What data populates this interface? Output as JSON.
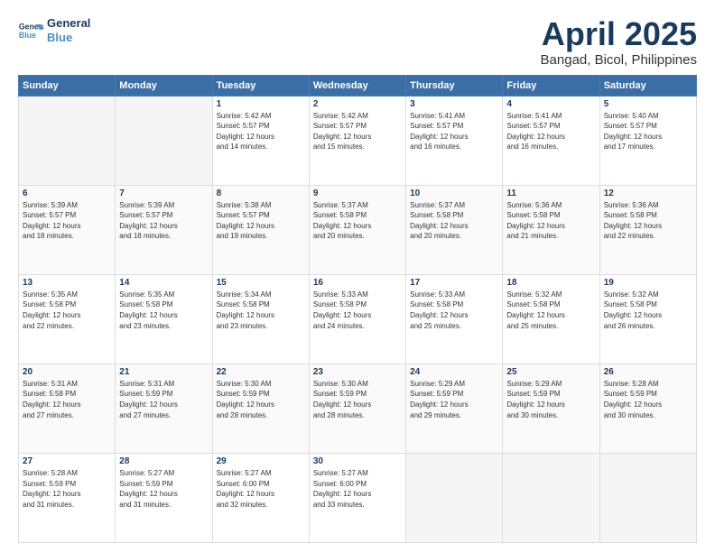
{
  "header": {
    "logo_line1": "General",
    "logo_line2": "Blue",
    "title": "April 2025",
    "subtitle": "Bangad, Bicol, Philippines"
  },
  "days_of_week": [
    "Sunday",
    "Monday",
    "Tuesday",
    "Wednesday",
    "Thursday",
    "Friday",
    "Saturday"
  ],
  "weeks": [
    [
      {
        "num": "",
        "text": ""
      },
      {
        "num": "",
        "text": ""
      },
      {
        "num": "1",
        "text": "Sunrise: 5:42 AM\nSunset: 5:57 PM\nDaylight: 12 hours\nand 14 minutes."
      },
      {
        "num": "2",
        "text": "Sunrise: 5:42 AM\nSunset: 5:57 PM\nDaylight: 12 hours\nand 15 minutes."
      },
      {
        "num": "3",
        "text": "Sunrise: 5:41 AM\nSunset: 5:57 PM\nDaylight: 12 hours\nand 16 minutes."
      },
      {
        "num": "4",
        "text": "Sunrise: 5:41 AM\nSunset: 5:57 PM\nDaylight: 12 hours\nand 16 minutes."
      },
      {
        "num": "5",
        "text": "Sunrise: 5:40 AM\nSunset: 5:57 PM\nDaylight: 12 hours\nand 17 minutes."
      }
    ],
    [
      {
        "num": "6",
        "text": "Sunrise: 5:39 AM\nSunset: 5:57 PM\nDaylight: 12 hours\nand 18 minutes."
      },
      {
        "num": "7",
        "text": "Sunrise: 5:39 AM\nSunset: 5:57 PM\nDaylight: 12 hours\nand 18 minutes."
      },
      {
        "num": "8",
        "text": "Sunrise: 5:38 AM\nSunset: 5:57 PM\nDaylight: 12 hours\nand 19 minutes."
      },
      {
        "num": "9",
        "text": "Sunrise: 5:37 AM\nSunset: 5:58 PM\nDaylight: 12 hours\nand 20 minutes."
      },
      {
        "num": "10",
        "text": "Sunrise: 5:37 AM\nSunset: 5:58 PM\nDaylight: 12 hours\nand 20 minutes."
      },
      {
        "num": "11",
        "text": "Sunrise: 5:36 AM\nSunset: 5:58 PM\nDaylight: 12 hours\nand 21 minutes."
      },
      {
        "num": "12",
        "text": "Sunrise: 5:36 AM\nSunset: 5:58 PM\nDaylight: 12 hours\nand 22 minutes."
      }
    ],
    [
      {
        "num": "13",
        "text": "Sunrise: 5:35 AM\nSunset: 5:58 PM\nDaylight: 12 hours\nand 22 minutes."
      },
      {
        "num": "14",
        "text": "Sunrise: 5:35 AM\nSunset: 5:58 PM\nDaylight: 12 hours\nand 23 minutes."
      },
      {
        "num": "15",
        "text": "Sunrise: 5:34 AM\nSunset: 5:58 PM\nDaylight: 12 hours\nand 23 minutes."
      },
      {
        "num": "16",
        "text": "Sunrise: 5:33 AM\nSunset: 5:58 PM\nDaylight: 12 hours\nand 24 minutes."
      },
      {
        "num": "17",
        "text": "Sunrise: 5:33 AM\nSunset: 5:58 PM\nDaylight: 12 hours\nand 25 minutes."
      },
      {
        "num": "18",
        "text": "Sunrise: 5:32 AM\nSunset: 5:58 PM\nDaylight: 12 hours\nand 25 minutes."
      },
      {
        "num": "19",
        "text": "Sunrise: 5:32 AM\nSunset: 5:58 PM\nDaylight: 12 hours\nand 26 minutes."
      }
    ],
    [
      {
        "num": "20",
        "text": "Sunrise: 5:31 AM\nSunset: 5:58 PM\nDaylight: 12 hours\nand 27 minutes."
      },
      {
        "num": "21",
        "text": "Sunrise: 5:31 AM\nSunset: 5:59 PM\nDaylight: 12 hours\nand 27 minutes."
      },
      {
        "num": "22",
        "text": "Sunrise: 5:30 AM\nSunset: 5:59 PM\nDaylight: 12 hours\nand 28 minutes."
      },
      {
        "num": "23",
        "text": "Sunrise: 5:30 AM\nSunset: 5:59 PM\nDaylight: 12 hours\nand 28 minutes."
      },
      {
        "num": "24",
        "text": "Sunrise: 5:29 AM\nSunset: 5:59 PM\nDaylight: 12 hours\nand 29 minutes."
      },
      {
        "num": "25",
        "text": "Sunrise: 5:29 AM\nSunset: 5:59 PM\nDaylight: 12 hours\nand 30 minutes."
      },
      {
        "num": "26",
        "text": "Sunrise: 5:28 AM\nSunset: 5:59 PM\nDaylight: 12 hours\nand 30 minutes."
      }
    ],
    [
      {
        "num": "27",
        "text": "Sunrise: 5:28 AM\nSunset: 5:59 PM\nDaylight: 12 hours\nand 31 minutes."
      },
      {
        "num": "28",
        "text": "Sunrise: 5:27 AM\nSunset: 5:59 PM\nDaylight: 12 hours\nand 31 minutes."
      },
      {
        "num": "29",
        "text": "Sunrise: 5:27 AM\nSunset: 6:00 PM\nDaylight: 12 hours\nand 32 minutes."
      },
      {
        "num": "30",
        "text": "Sunrise: 5:27 AM\nSunset: 6:00 PM\nDaylight: 12 hours\nand 33 minutes."
      },
      {
        "num": "",
        "text": ""
      },
      {
        "num": "",
        "text": ""
      },
      {
        "num": "",
        "text": ""
      }
    ]
  ]
}
